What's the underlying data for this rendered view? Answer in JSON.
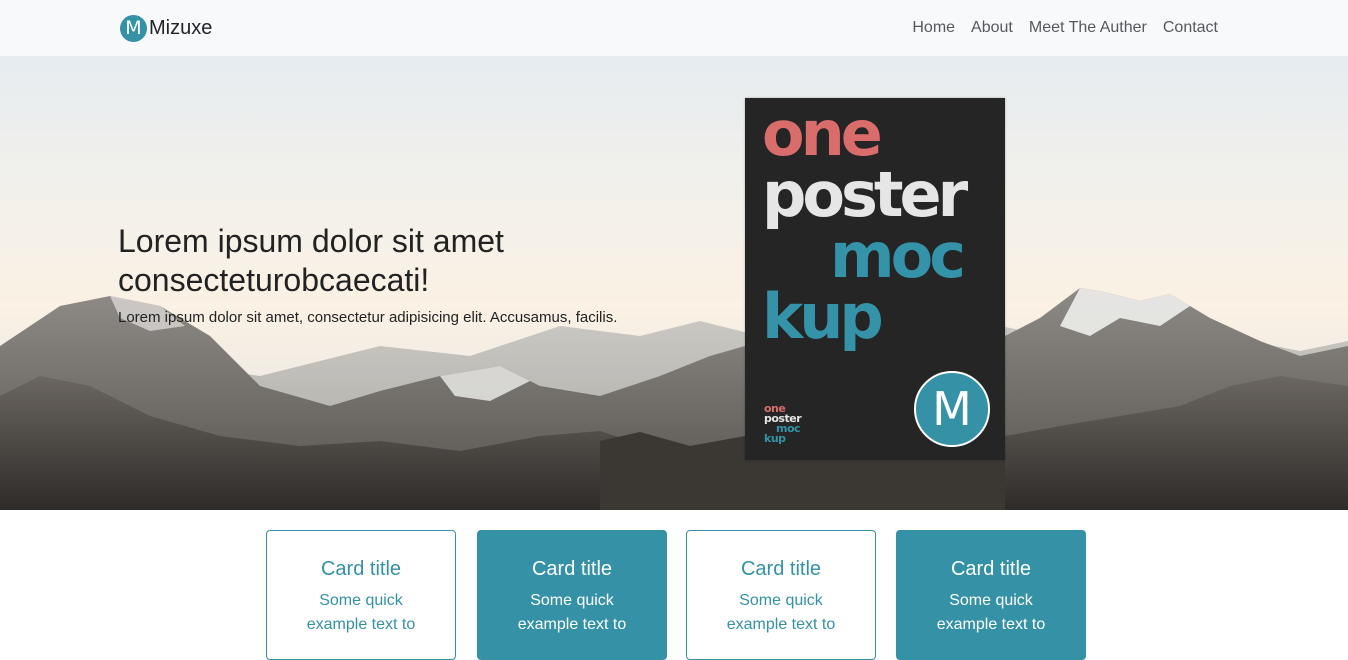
{
  "navbar": {
    "brand_logo": "M",
    "brand_name": "Mizuxe",
    "links": [
      "Home",
      "About",
      "Meet The Auther",
      "Contact"
    ]
  },
  "hero": {
    "title": "Lorem ipsum dolor sit amet consecteturobcaecati!",
    "text": "Lorem ipsum dolor sit amet, consectetur adipisicing elit. Accusamus, facilis."
  },
  "poster": {
    "line1": "one",
    "line2": "poster",
    "line3": "moc",
    "line4": "kup",
    "badge": "M",
    "colors": {
      "one": "#d96d6c",
      "poster": "#e6e6e6",
      "mockup": "#3493a8",
      "background": "#252525"
    }
  },
  "cards": [
    {
      "title": "Card title",
      "text": "Some quick example text to",
      "style": "outline"
    },
    {
      "title": "Card title",
      "text": "Some quick example text to",
      "style": "filled"
    },
    {
      "title": "Card title",
      "text": "Some quick example text to",
      "style": "outline"
    },
    {
      "title": "Card title",
      "text": "Some quick example text to",
      "style": "filled"
    }
  ],
  "theme": {
    "accent": "#3491a6",
    "navbar_bg": "#f8f9fa"
  }
}
